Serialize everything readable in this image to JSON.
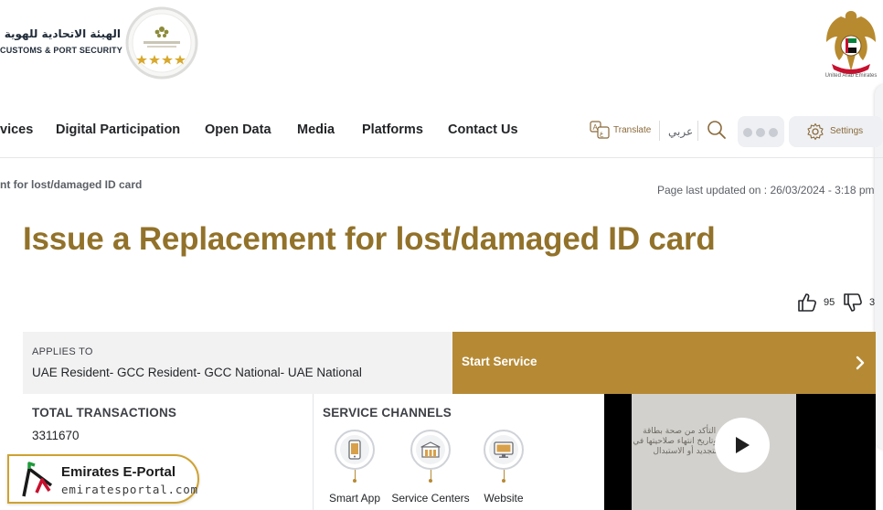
{
  "header": {
    "logo_arabic": "الهيئة الاتحادية للهوية",
    "logo_english": "CUSTOMS & PORT SECURITY",
    "uae_caption": "United Arab Emirates"
  },
  "nav": {
    "items": [
      {
        "label": "vices"
      },
      {
        "label": "Digital Participation"
      },
      {
        "label": "Open Data"
      },
      {
        "label": "Media"
      },
      {
        "label": "Platforms"
      },
      {
        "label": "Contact Us"
      }
    ],
    "translate_label": "Translate",
    "arabic_label": "عربي",
    "settings_label": "Settings"
  },
  "breadcrumb": "nt for lost/damaged ID card",
  "page_updated": {
    "label": "Page last updated on :",
    "value": "26/03/2024 - 3:18 pm"
  },
  "page_title": "Issue a Replacement for lost/damaged ID card",
  "feedback": {
    "likes": "95",
    "dislikes": "3"
  },
  "applies_to": {
    "label": "APPLIES TO",
    "value": "UAE Resident- GCC Resident- GCC National- UAE National"
  },
  "start_service": {
    "label": "Start Service"
  },
  "transactions": {
    "label": "TOTAL TRANSACTIONS",
    "value": "3311670"
  },
  "service_channels": {
    "label": "SERVICE CHANNELS",
    "items": [
      {
        "label": "Smart App",
        "icon": "smartphone-icon"
      },
      {
        "label": "Service Centers",
        "icon": "building-icon"
      },
      {
        "label": "Website",
        "icon": "monitor-icon"
      }
    ]
  },
  "video": {
    "overlay_text": "يمكنك التأكد من صحة بطاقة الهوية وتاريخ انتهاء صلاحيتها في طلب التجديد أو الاستبدال"
  },
  "watermark": {
    "title": "Emirates E-Portal",
    "url": "emiratesportal.com"
  },
  "colors": {
    "gold": "#b68a35",
    "title_gold": "#92722a",
    "text": "#232528"
  }
}
